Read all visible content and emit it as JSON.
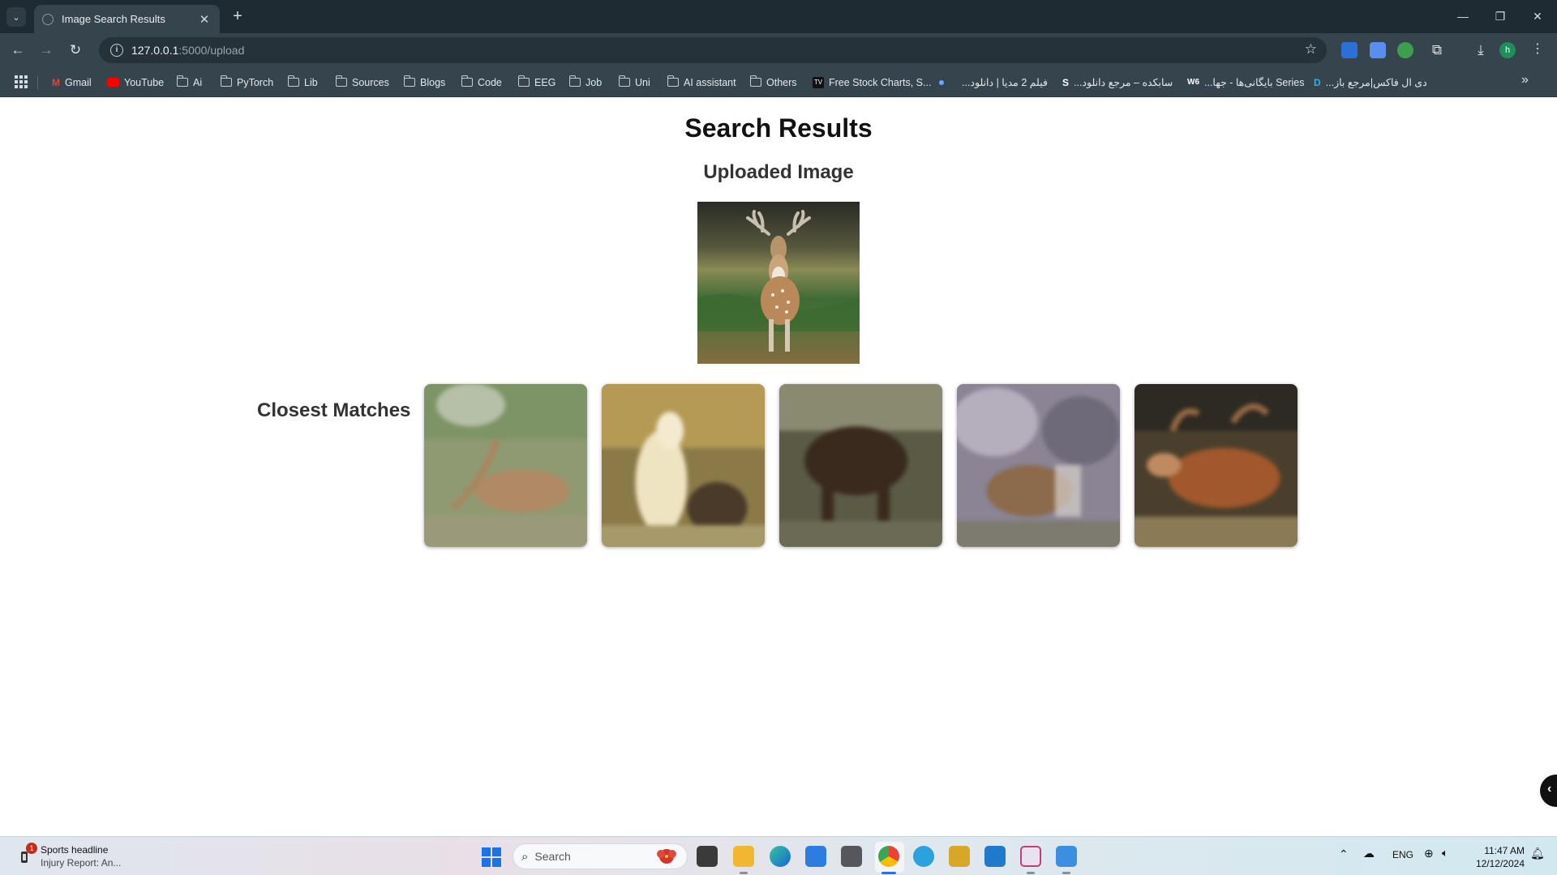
{
  "browser": {
    "tab_title": "Image Search Results",
    "url_host": "127.0.0.1",
    "url_path": ":5000/upload",
    "profile_initial": "h",
    "bookmarks": [
      {
        "label": "Gmail",
        "icon": "gmail-icon"
      },
      {
        "label": "YouTube",
        "icon": "youtube-icon"
      },
      {
        "label": "Ai",
        "icon": "folder-icon"
      },
      {
        "label": "PyTorch",
        "icon": "folder-icon"
      },
      {
        "label": "Lib",
        "icon": "folder-icon"
      },
      {
        "label": "Sources",
        "icon": "folder-icon"
      },
      {
        "label": "Blogs",
        "icon": "folder-icon"
      },
      {
        "label": "Code",
        "icon": "folder-icon"
      },
      {
        "label": "EEG",
        "icon": "folder-icon"
      },
      {
        "label": "Job",
        "icon": "folder-icon"
      },
      {
        "label": "Uni",
        "icon": "folder-icon"
      },
      {
        "label": "AI assistant",
        "icon": "folder-icon"
      },
      {
        "label": "Others",
        "icon": "folder-icon"
      },
      {
        "label": "Free Stock Charts, S...",
        "icon": "tradingview-icon"
      },
      {
        "label": "فیلم 2 مدیا | دانلود...",
        "icon": "dot-icon"
      },
      {
        "label": "سابکده – مرجع دانلود...",
        "icon": "s-icon"
      },
      {
        "label": "Series بایگانی‌ها - جها...",
        "icon": "w-icon"
      },
      {
        "label": "دی ال فاکس|مرجع باز...",
        "icon": "d-icon"
      }
    ]
  },
  "page": {
    "title": "Search Results",
    "uploaded_heading": "Uploaded Image",
    "matches_heading": "Closest Matches"
  },
  "taskbar": {
    "news_title": "Sports headline",
    "news_subtitle": "Injury Report: An...",
    "notification_count": "1",
    "search_placeholder": "Search",
    "language": "ENG",
    "time": "11:47 AM",
    "date": "12/12/2024"
  }
}
